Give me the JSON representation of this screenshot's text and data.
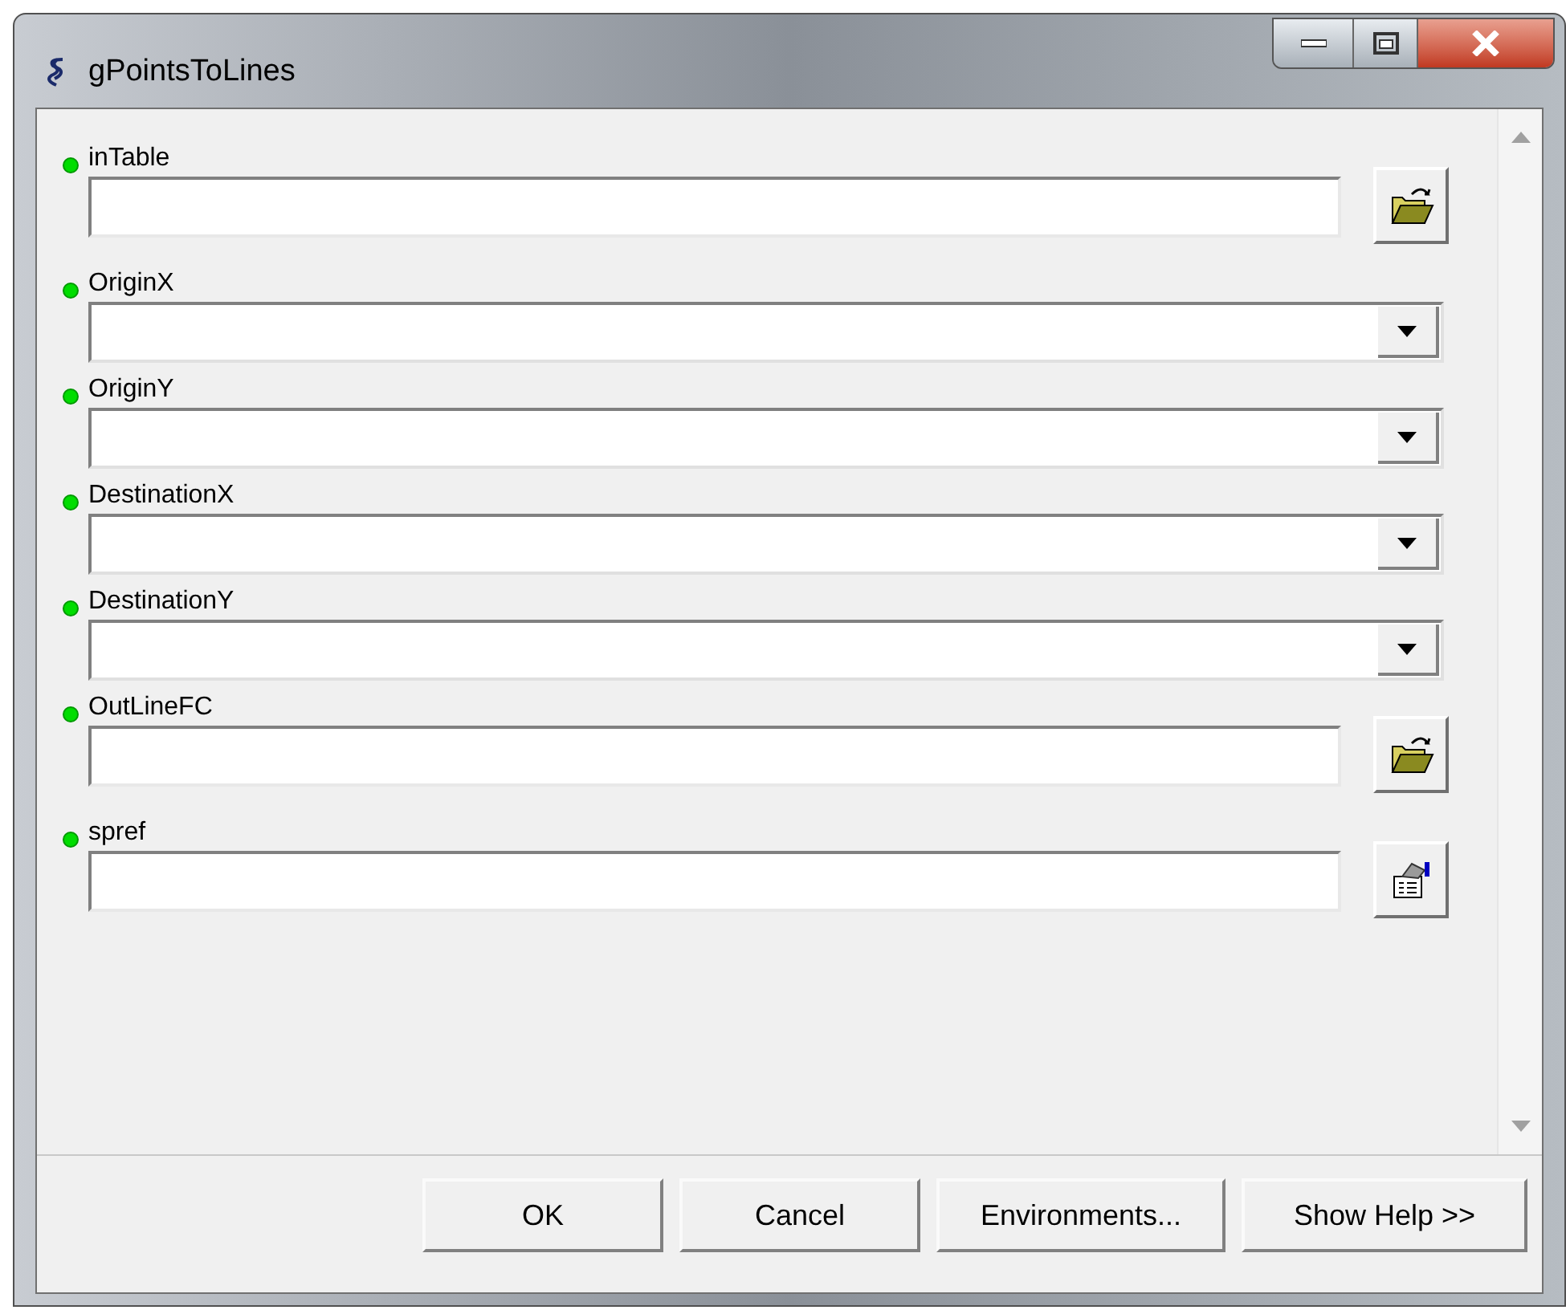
{
  "window": {
    "title": "gPointsToLines"
  },
  "parameters": [
    {
      "label": "inTable",
      "kind": "file",
      "required": true
    },
    {
      "label": "OriginX",
      "kind": "dropdown",
      "required": true
    },
    {
      "label": "OriginY",
      "kind": "dropdown",
      "required": true
    },
    {
      "label": "DestinationX",
      "kind": "dropdown",
      "required": true
    },
    {
      "label": "DestinationY",
      "kind": "dropdown",
      "required": true
    },
    {
      "label": "OutLineFC",
      "kind": "file",
      "required": true
    },
    {
      "label": "spref",
      "kind": "spatial-ref",
      "required": true
    }
  ],
  "buttons": [
    "OK",
    "Cancel",
    "Environments...",
    "Show Help >>"
  ]
}
